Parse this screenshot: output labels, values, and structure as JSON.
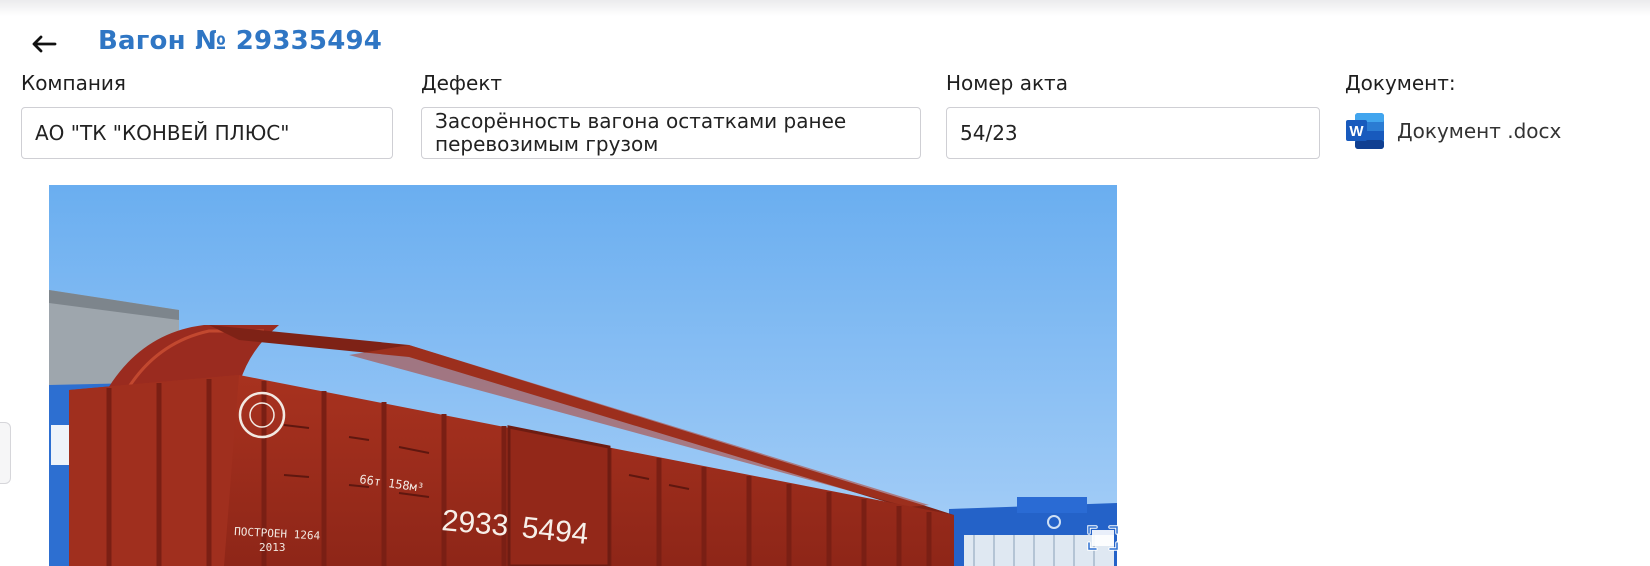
{
  "header": {
    "title": "Вагон № 29335494"
  },
  "fields": {
    "company": {
      "label": "Компания",
      "value": "АО \"ТК \"КОНВЕЙ ПЛЮС\""
    },
    "defect": {
      "label": "Дефект",
      "value": "Засорённость вагона остатками ранее перевозимым грузом"
    },
    "act_number": {
      "label": "Номер акта",
      "value": "54/23"
    },
    "document": {
      "label": "Документ:",
      "file_name": "Документ .docx",
      "icon": "word-icon"
    }
  },
  "photo": {
    "car_number_left": "2933",
    "car_number_right": "5494",
    "stencil_built": "ПОСТРОЕН 1264",
    "stencil_year": "2013",
    "stencil_capacity": "66т 158м³"
  },
  "colors": {
    "accent": "#2f76c4",
    "wagon_red": "#9a2b1f",
    "sky": "#7fb8f0",
    "word_blue": "#185abd"
  }
}
